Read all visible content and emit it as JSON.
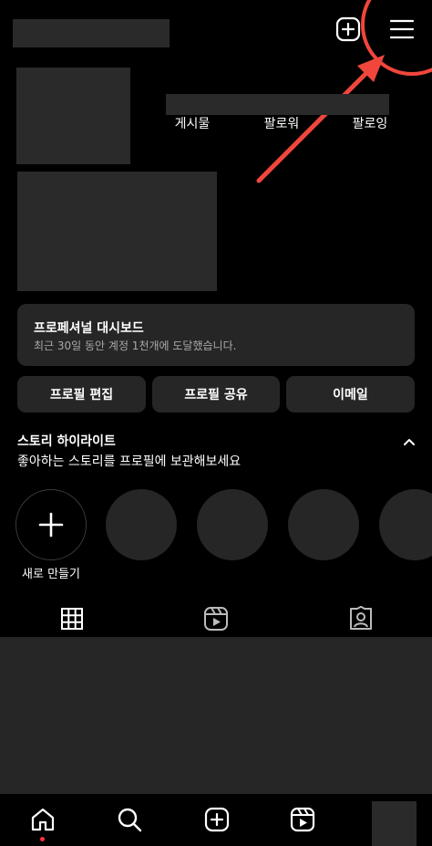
{
  "header": {
    "username": "",
    "add_icon": "plus-square-icon",
    "menu_icon": "hamburger-menu-icon"
  },
  "profile": {
    "stats": [
      {
        "label": "게시물"
      },
      {
        "label": "팔로워"
      },
      {
        "label": "팔로잉"
      }
    ]
  },
  "dashboard": {
    "title": "프로페셔널 대시보드",
    "subtitle": "최근 30일 동안 계정 1천개에 도달했습니다."
  },
  "buttons": {
    "edit_profile": "프로필 편집",
    "share_profile": "프로필 공유",
    "email": "이메일"
  },
  "highlights": {
    "title": "스토리 하이라이트",
    "subtitle": "좋아하는 스토리를 프로필에 보관해보세요",
    "new_label": "새로 만들기",
    "collapse_icon": "chevron-up-icon"
  },
  "tabs": [
    "grid-icon",
    "reels-icon",
    "tagged-icon"
  ],
  "bottom_nav": [
    "home-icon",
    "search-icon",
    "create-icon",
    "reels-icon",
    "profile-avatar"
  ],
  "annotation": {
    "color": "#f0463c"
  }
}
